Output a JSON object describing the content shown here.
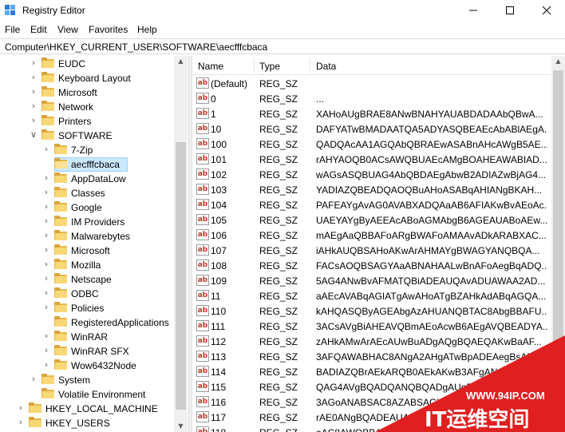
{
  "window": {
    "title": "Registry Editor"
  },
  "menu": [
    "File",
    "Edit",
    "View",
    "Favorites",
    "Help"
  ],
  "address": "Computer\\HKEY_CURRENT_USER\\SOFTWARE\\aecfffcbaca",
  "tree": {
    "items": [
      {
        "label": "EUDC",
        "level": 2,
        "expander": "right",
        "state": "normal"
      },
      {
        "label": "Keyboard Layout",
        "level": 2,
        "expander": "right",
        "state": "normal"
      },
      {
        "label": "Microsoft",
        "level": 2,
        "expander": "right",
        "state": "normal"
      },
      {
        "label": "Network",
        "level": 2,
        "expander": "right",
        "state": "normal"
      },
      {
        "label": "Printers",
        "level": 2,
        "expander": "right",
        "state": "normal"
      },
      {
        "label": "SOFTWARE",
        "level": 2,
        "expander": "down",
        "state": "expanded"
      },
      {
        "label": "7-Zip",
        "level": 3,
        "expander": "right",
        "state": "normal"
      },
      {
        "label": "aecfffcbaca",
        "level": 3,
        "expander": "none",
        "state": "selected"
      },
      {
        "label": "AppDataLow",
        "level": 3,
        "expander": "right",
        "state": "normal"
      },
      {
        "label": "Classes",
        "level": 3,
        "expander": "right",
        "state": "normal"
      },
      {
        "label": "Google",
        "level": 3,
        "expander": "right",
        "state": "normal"
      },
      {
        "label": "IM Providers",
        "level": 3,
        "expander": "right",
        "state": "normal"
      },
      {
        "label": "Malwarebytes",
        "level": 3,
        "expander": "right",
        "state": "normal"
      },
      {
        "label": "Microsoft",
        "level": 3,
        "expander": "right",
        "state": "normal"
      },
      {
        "label": "Mozilla",
        "level": 3,
        "expander": "right",
        "state": "normal"
      },
      {
        "label": "Netscape",
        "level": 3,
        "expander": "right",
        "state": "normal"
      },
      {
        "label": "ODBC",
        "level": 3,
        "expander": "right",
        "state": "normal"
      },
      {
        "label": "Policies",
        "level": 3,
        "expander": "right",
        "state": "normal"
      },
      {
        "label": "RegisteredApplications",
        "level": 3,
        "expander": "none",
        "state": "normal"
      },
      {
        "label": "WinRAR",
        "level": 3,
        "expander": "right",
        "state": "normal"
      },
      {
        "label": "WinRAR SFX",
        "level": 3,
        "expander": "right",
        "state": "normal"
      },
      {
        "label": "Wow6432Node",
        "level": 3,
        "expander": "right",
        "state": "normal"
      },
      {
        "label": "System",
        "level": 2,
        "expander": "right",
        "state": "normal"
      },
      {
        "label": "Volatile Environment",
        "level": 2,
        "expander": "none",
        "state": "normal"
      },
      {
        "label": "HKEY_LOCAL_MACHINE",
        "level": 1,
        "expander": "right",
        "state": "normal"
      },
      {
        "label": "HKEY_USERS",
        "level": 1,
        "expander": "right",
        "state": "normal"
      }
    ]
  },
  "list": {
    "columns": {
      "name": "Name",
      "type": "Type",
      "data": "Data"
    },
    "rows": [
      {
        "name": "(Default)",
        "type": "REG_SZ",
        "data": ""
      },
      {
        "name": "0",
        "type": "REG_SZ",
        "data": "..."
      },
      {
        "name": "1",
        "type": "REG_SZ",
        "data": "XAHoAUgBRAE8ANwBNAHYAUABDADAAbQBwA..."
      },
      {
        "name": "10",
        "type": "REG_SZ",
        "data": "DAFYATwBMADAATQA5ADYASQBEAEcAbABlAEgA..."
      },
      {
        "name": "100",
        "type": "REG_SZ",
        "data": "QADQAcAA1AGQAbQBRAEwASABnAHcAWgB5AE..."
      },
      {
        "name": "101",
        "type": "REG_SZ",
        "data": "rAHYAOQB0ACsAWQBUAEcAMgBOAHEAWABIAD..."
      },
      {
        "name": "102",
        "type": "REG_SZ",
        "data": "wAGsASQBUAG4AbQBDAEgAbwB2ADIAZwBjAG4..."
      },
      {
        "name": "103",
        "type": "REG_SZ",
        "data": "YADIAZQBEADQAOQBuAHoASABqAHIANgBKAH..."
      },
      {
        "name": "104",
        "type": "REG_SZ",
        "data": "PAFEAYgAvAG0AVABXADQAaAB6AFIAKwBvAEoAc..."
      },
      {
        "name": "105",
        "type": "REG_SZ",
        "data": "UAEYAYgByAEEAcABoAGMAbgB6AGEAUABoAEw..."
      },
      {
        "name": "106",
        "type": "REG_SZ",
        "data": "mAEgAaQBBAFoARgBWAFoAMAAvADkARABXAC..."
      },
      {
        "name": "107",
        "type": "REG_SZ",
        "data": "iAHkAUQBSAHoAKwArAHMAYgBWAGYANQBQA..."
      },
      {
        "name": "108",
        "type": "REG_SZ",
        "data": "FACsAOQBSAGYAaABNAHAALwBnAFoAegBqADQ..."
      },
      {
        "name": "109",
        "type": "REG_SZ",
        "data": "5AG4ANwBvAFMATQBiADEAUQAvADUAWAA2AD..."
      },
      {
        "name": "11",
        "type": "REG_SZ",
        "data": "aAEcAVABqAGIATgAwAHoATgBZAHkAdABqAGQA..."
      },
      {
        "name": "110",
        "type": "REG_SZ",
        "data": "kAHQASQByAGEAbgAzAHUANQBTAC8AbgBBAFU..."
      },
      {
        "name": "111",
        "type": "REG_SZ",
        "data": "3ACsAVgBiAHEAVQBmAEoAcwB6AEgAVQBEADYA..."
      },
      {
        "name": "112",
        "type": "REG_SZ",
        "data": "zAHkAMwArAEcAUwBuADgAQgBQAEQAKwBaAF..."
      },
      {
        "name": "113",
        "type": "REG_SZ",
        "data": "3AFQAWABHAC8ANgA2AHgATwBpADEAegBsAE8..."
      },
      {
        "name": "114",
        "type": "REG_SZ",
        "data": "BADIAZQBrAEkARQB0AEkAKwB3AFgANgBT..."
      },
      {
        "name": "115",
        "type": "REG_SZ",
        "data": "QAG4AVgBQADQANQBQADgAUgBtA..."
      },
      {
        "name": "116",
        "type": "REG_SZ",
        "data": "3AGoANABSAC8AZABSAGYA..."
      },
      {
        "name": "117",
        "type": "REG_SZ",
        "data": "rAE0ANgBQADEAUAA..."
      },
      {
        "name": "118",
        "type": "REG_SZ",
        "data": "aAC8AWQBBAD..."
      }
    ]
  },
  "watermark": {
    "url": "WWW.94IP.COM",
    "text": "IT运维空间"
  },
  "colors": {
    "selection": "#cce8ff",
    "folder": "#f8d775",
    "value_icon": "#c0392b",
    "watermark": "#e02020"
  },
  "icons": {
    "app": "registry-editor-icon",
    "folder": "folder-icon",
    "value": "string-value-icon"
  }
}
